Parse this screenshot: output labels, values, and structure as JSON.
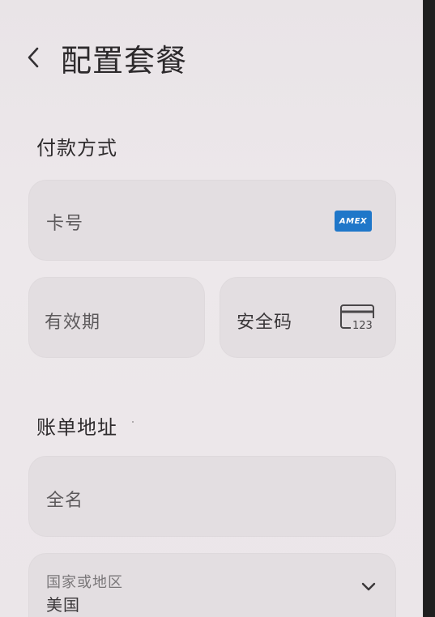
{
  "header": {
    "title": "配置套餐",
    "back_icon": "chevron-left-icon"
  },
  "payment": {
    "section_title": "付款方式",
    "card_number_label": "卡号",
    "card_brand_text": "AMEX",
    "expiry_label": "有效期",
    "security_code_label": "安全码",
    "security_code_hint": "123"
  },
  "billing": {
    "section_title": "账单地址",
    "full_name_label": "全名",
    "country_label": "国家或地区",
    "country_value": "美国",
    "dropdown_icon": "chevron-down-icon"
  },
  "colors": {
    "background": "#ebe6e9",
    "field_background": "#e3dee1",
    "amex_blue": "#1f77c9",
    "text_primary": "#2d2a2c"
  }
}
